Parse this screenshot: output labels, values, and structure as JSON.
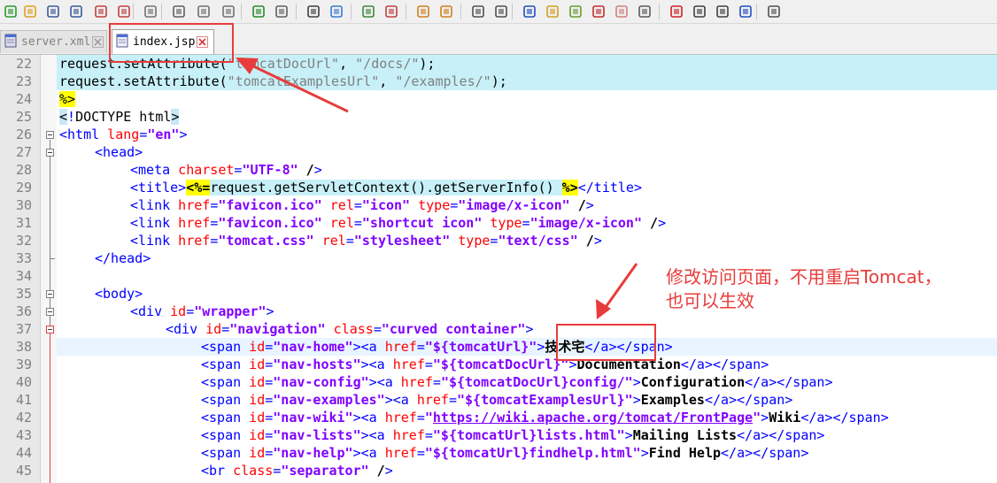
{
  "toolbar": {
    "icons": [
      "new-file-icon",
      "open-file-icon",
      "save-icon",
      "save-all-icon",
      "close-icon",
      "close-all-icon",
      "print-icon",
      "cut-icon",
      "copy-icon",
      "paste-icon",
      "undo-icon",
      "redo-icon",
      "find-icon",
      "replace-icon",
      "zoom-in-icon",
      "zoom-out-icon",
      "sync-v-icon",
      "sync-h-icon",
      "word-wrap-icon",
      "show-all-chars-icon",
      "indent-guide-icon",
      "lang-icon",
      "doc-map-icon",
      "function-list-icon",
      "folder-icon",
      "monitor-icon",
      "record-macro-icon",
      "stop-macro-icon",
      "play-macro-icon",
      "run-macro-multi-icon",
      "save-macro-icon"
    ]
  },
  "tabs": [
    {
      "label": "server.xml",
      "active": false
    },
    {
      "label": "index.jsp",
      "active": true
    }
  ],
  "editor": {
    "lines": [
      {
        "n": "22",
        "text": "request.setAttribute(\"tomcatDocUrl\", \"/docs/\");"
      },
      {
        "n": "23",
        "text": "request.setAttribute(\"tomcatExamplesUrl\", \"/examples/\");"
      },
      {
        "n": "24",
        "text": "%>"
      },
      {
        "n": "25",
        "text": "<!DOCTYPE html>"
      },
      {
        "n": "26",
        "text": "<html lang=\"en\">"
      },
      {
        "n": "27",
        "text": "<head>"
      },
      {
        "n": "28",
        "text": "<meta charset=\"UTF-8\" />"
      },
      {
        "n": "29",
        "text": "<title><%=request.getServletContext().getServerInfo() %></title>"
      },
      {
        "n": "30",
        "text": "<link href=\"favicon.ico\" rel=\"icon\" type=\"image/x-icon\" />"
      },
      {
        "n": "31",
        "text": "<link href=\"favicon.ico\" rel=\"shortcut icon\" type=\"image/x-icon\" />"
      },
      {
        "n": "32",
        "text": "<link href=\"tomcat.css\" rel=\"stylesheet\" type=\"text/css\" />"
      },
      {
        "n": "33",
        "text": "</head>"
      },
      {
        "n": "34",
        "text": ""
      },
      {
        "n": "35",
        "text": "<body>"
      },
      {
        "n": "36",
        "text": "<div id=\"wrapper\">"
      },
      {
        "n": "37",
        "text": "<div id=\"navigation\" class=\"curved container\">"
      },
      {
        "n": "38",
        "text": "<span id=\"nav-home\"><a href=\"${tomcatUrl}\">技术宅</a></span>"
      },
      {
        "n": "39",
        "text": "<span id=\"nav-hosts\"><a href=\"${tomcatDocUrl}\">Documentation</a></span>"
      },
      {
        "n": "40",
        "text": "<span id=\"nav-config\"><a href=\"${tomcatDocUrl}config/\">Configuration</a></span>"
      },
      {
        "n": "41",
        "text": "<span id=\"nav-examples\"><a href=\"${tomcatExamplesUrl}\">Examples</a></span>"
      },
      {
        "n": "42",
        "text": "<span id=\"nav-wiki\"><a href=\"https://wiki.apache.org/tomcat/FrontPage\">Wiki</a></span>"
      },
      {
        "n": "43",
        "text": "<span id=\"nav-lists\"><a href=\"${tomcatUrl}lists.html\">Mailing Lists</a></span>"
      },
      {
        "n": "44",
        "text": "<span id=\"nav-help\"><a href=\"${tomcatUrl}findhelp.html\">Find Help</a></span>"
      },
      {
        "n": "45",
        "text": "<br class=\"separator\" />"
      }
    ]
  },
  "annotation": {
    "line1": "修改访问页面，不用重启Tomcat，",
    "line2": "也可以生效"
  },
  "colors": {
    "highlight": "#c8f0f8",
    "current_line": "#e8f4ff",
    "annotation": "#e83b3b",
    "tag": "#0000ff",
    "attr": "#ff0000",
    "value": "#8000ff"
  }
}
